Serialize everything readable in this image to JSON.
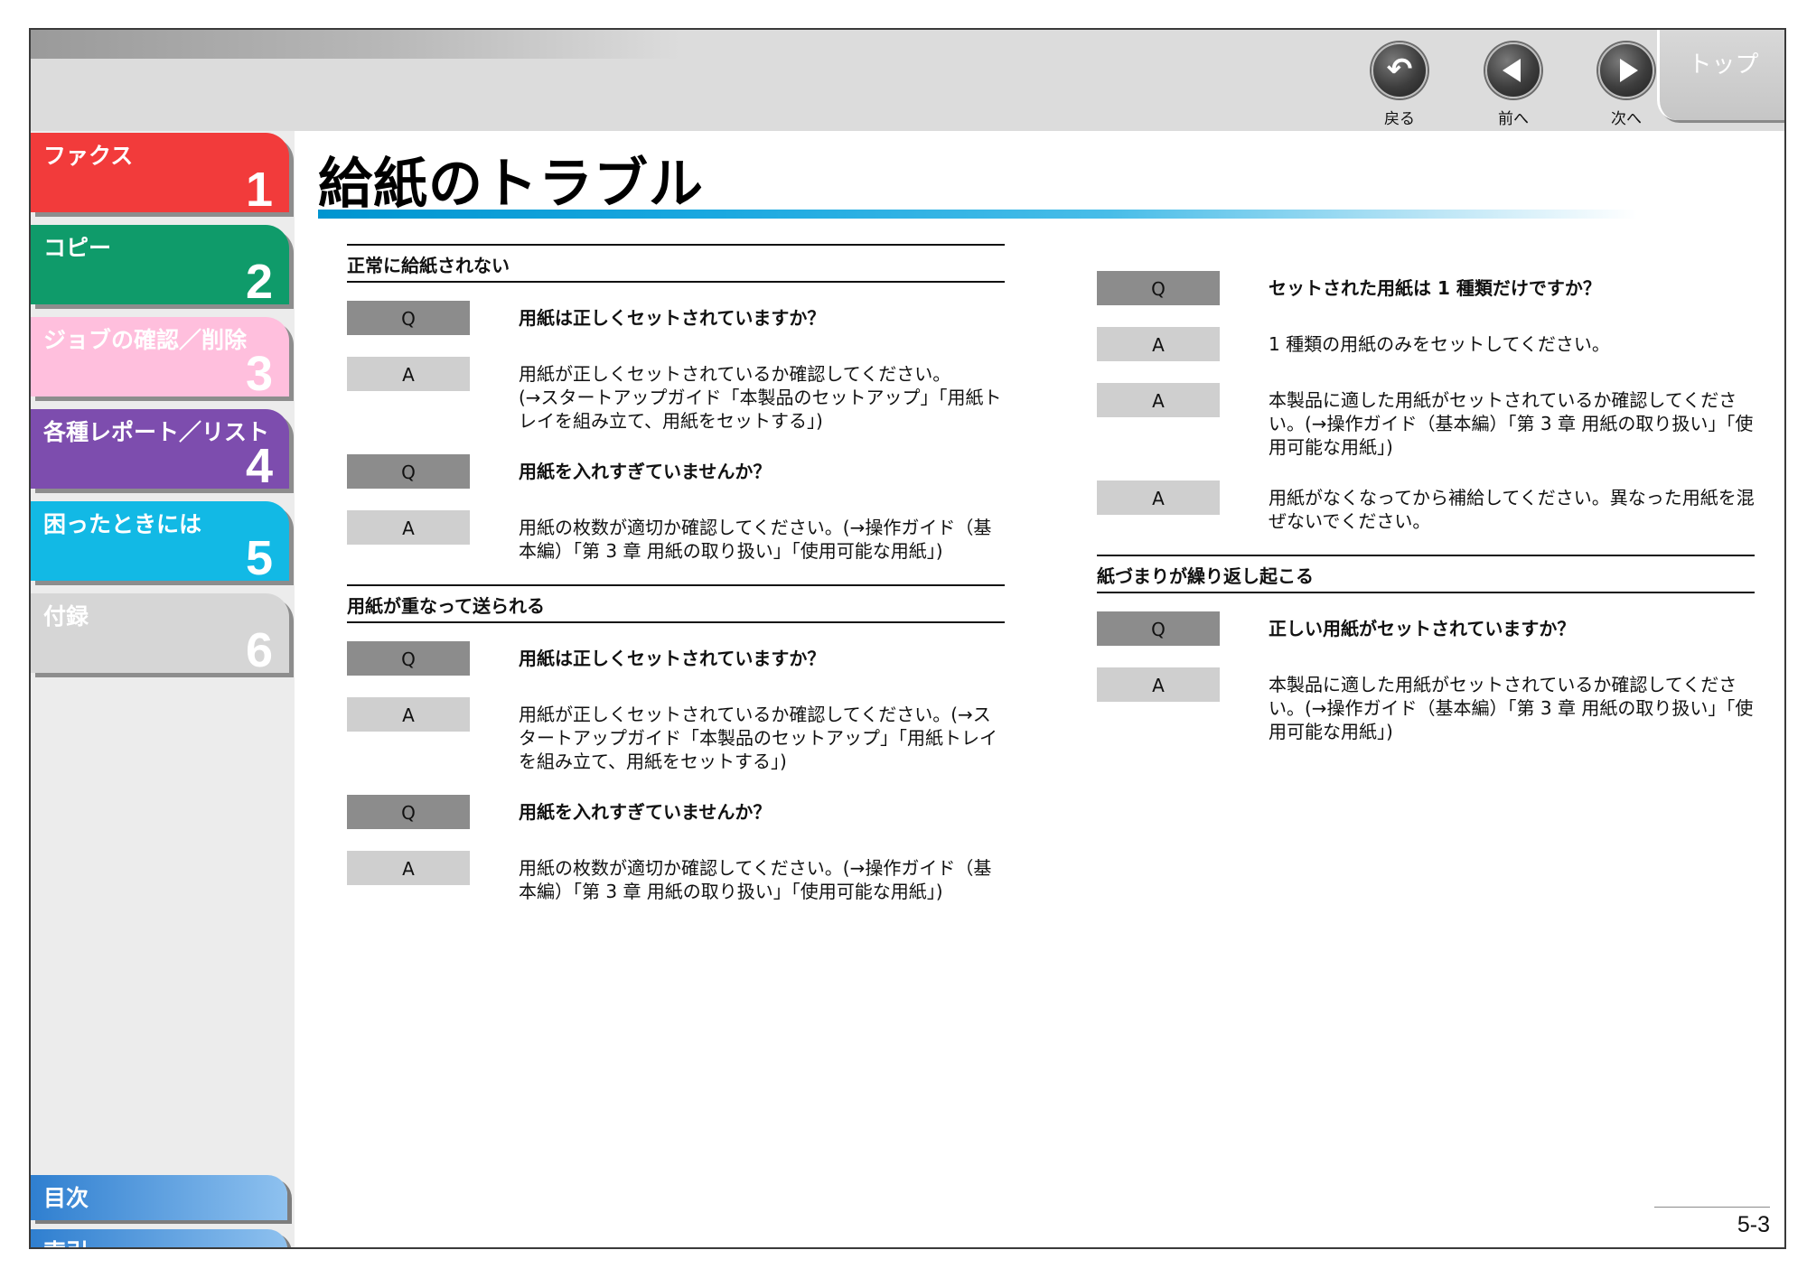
{
  "nav": {
    "back": "戻る",
    "prev": "前へ",
    "next": "次へ",
    "top": "トップ"
  },
  "colors": {
    "ch1": "#f23b3b",
    "ch2": "#0f9b6a",
    "ch3": "#ffbfdd",
    "ch4": "#7d4dae",
    "ch5": "#12b9e5",
    "ch6": "#d6d6d6",
    "title_bar": "#0095d0"
  },
  "sidebar": {
    "chapters": [
      {
        "label": "ファクス",
        "num": "1"
      },
      {
        "label": "コピー",
        "num": "2"
      },
      {
        "label": "ジョブの確認／削除",
        "num": "3"
      },
      {
        "label": "各種レポート／リスト",
        "num": "4"
      },
      {
        "label": "困ったときには",
        "num": "5"
      },
      {
        "label": "付録",
        "num": "6"
      }
    ],
    "toc": "目次",
    "index": "索引"
  },
  "page": {
    "title": "給紙のトラブル",
    "number": "5-3"
  },
  "left": {
    "s1": {
      "heading": "正常に給紙されない",
      "items": [
        {
          "badge": "Q",
          "text": "用紙は正しくセットされていますか？"
        },
        {
          "badge": "A",
          "text": "用紙が正しくセットされているか確認してください。\n(→スタートアップガイド「本製品のセットアップ」「用紙トレイを組み立て、用紙をセットする」)"
        },
        {
          "badge": "Q",
          "text": "用紙を入れすぎていませんか？"
        },
        {
          "badge": "A",
          "text": "用紙の枚数が適切か確認してください。(→操作ガイド（基本編）「第 3 章 用紙の取り扱い」「使用可能な用紙」)"
        }
      ]
    },
    "s2": {
      "heading": "用紙が重なって送られる",
      "items": [
        {
          "badge": "Q",
          "text": "用紙は正しくセットされていますか？"
        },
        {
          "badge": "A",
          "text": "用紙が正しくセットされているか確認してください。(→スタートアップガイド「本製品のセットアップ」「用紙トレイを組み立て、用紙をセットする」)"
        },
        {
          "badge": "Q",
          "text": "用紙を入れすぎていませんか？"
        },
        {
          "badge": "A",
          "text": "用紙の枚数が適切か確認してください。(→操作ガイド（基本編）「第 3 章 用紙の取り扱い」「使用可能な用紙」)"
        }
      ]
    }
  },
  "right": {
    "s0": {
      "items": [
        {
          "badge": "Q",
          "text": "セットされた用紙は 1 種類だけですか？"
        },
        {
          "badge": "A",
          "text": "1 種類の用紙のみをセットしてください。"
        },
        {
          "badge": "A",
          "text": "本製品に適した用紙がセットされているか確認してください。(→操作ガイド（基本編）「第 3 章 用紙の取り扱い」「使用可能な用紙」)"
        },
        {
          "badge": "A",
          "text": "用紙がなくなってから補給してください。異なった用紙を混ぜないでください。"
        }
      ]
    },
    "s1": {
      "heading": "紙づまりが繰り返し起こる",
      "items": [
        {
          "badge": "Q",
          "text": "正しい用紙がセットされていますか？"
        },
        {
          "badge": "A",
          "text": "本製品に適した用紙がセットされているか確認してください。(→操作ガイド（基本編）「第 3 章 用紙の取り扱い」「使用可能な用紙」)"
        }
      ]
    }
  }
}
